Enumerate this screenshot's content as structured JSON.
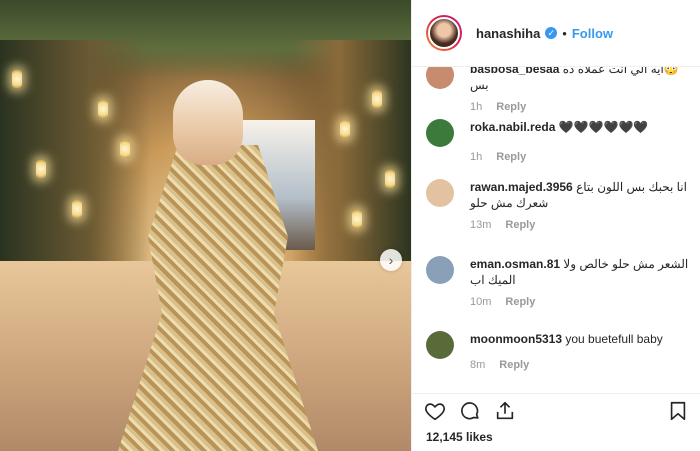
{
  "header": {
    "username": "hanashiha",
    "follow_label": "Follow",
    "dot": "•"
  },
  "comments": [
    {
      "user": "basbosa_besaa",
      "text": "😳ايه الي انت عملاه ده بس",
      "time": "1h",
      "reply": "Reply",
      "avatar_color": "#c78b6d"
    },
    {
      "user": "roka.nabil.reda",
      "text": "🖤🖤🖤🖤🖤🖤",
      "time": "1h",
      "reply": "Reply",
      "avatar_color": "#3b7a3b"
    },
    {
      "user": "rawan.majed.3956",
      "text": "انا بحبك بس اللون بتاع شعرك مش حلو",
      "time": "13m",
      "reply": "Reply",
      "avatar_color": "#e3c2a2"
    },
    {
      "user": "eman.osman.81",
      "text": "الشعر مش حلو خالص ولا الميك اب",
      "time": "10m",
      "reply": "Reply",
      "avatar_color": "#8aa0b8"
    },
    {
      "user": "moonmoon5313",
      "text": "you buetefull baby",
      "time": "8m",
      "reply": "Reply",
      "avatar_color": "#5a6b3a"
    }
  ],
  "actions": {
    "like_icon": "heart-icon",
    "comment_icon": "comment-icon",
    "share_icon": "share-icon",
    "save_icon": "bookmark-icon"
  },
  "likes_text": "12,145 likes",
  "media": {
    "next_glyph": "›"
  },
  "colors": {
    "accent": "#3897f0",
    "muted": "#999999",
    "border": "#efefef"
  }
}
